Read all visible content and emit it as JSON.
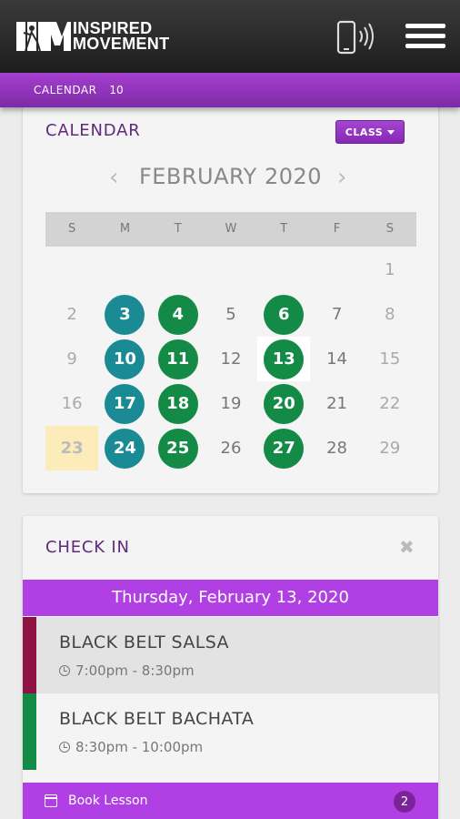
{
  "header": {
    "brand_line1": "INSPIRED",
    "brand_line2": "MOVEMENT",
    "logo_mark": "IM",
    "icons": [
      "phone-signal-icon",
      "hamburger-menu-icon"
    ]
  },
  "subnav": {
    "label": "CALENDAR",
    "count": "10"
  },
  "calendar": {
    "title": "CALENDAR",
    "class_button": "CLASS",
    "month": "FEBRUARY 2020",
    "prev_icon": "‹",
    "next_icon": "›",
    "weekdays": [
      "S",
      "M",
      "T",
      "W",
      "T",
      "F",
      "S"
    ],
    "weeks": [
      [
        {
          "d": ""
        },
        {
          "d": ""
        },
        {
          "d": ""
        },
        {
          "d": ""
        },
        {
          "d": ""
        },
        {
          "d": ""
        },
        {
          "d": "1"
        }
      ],
      [
        {
          "d": "2"
        },
        {
          "d": "3",
          "dot": "teal"
        },
        {
          "d": "4",
          "dot": "green"
        },
        {
          "d": "5",
          "cur": true
        },
        {
          "d": "6",
          "dot": "green"
        },
        {
          "d": "7",
          "cur": true
        },
        {
          "d": "8"
        }
      ],
      [
        {
          "d": "9"
        },
        {
          "d": "10",
          "dot": "teal"
        },
        {
          "d": "11",
          "dot": "green"
        },
        {
          "d": "12",
          "cur": true
        },
        {
          "d": "13",
          "dot": "green",
          "selected": true
        },
        {
          "d": "14",
          "cur": true
        },
        {
          "d": "15"
        }
      ],
      [
        {
          "d": "16"
        },
        {
          "d": "17",
          "dot": "teal"
        },
        {
          "d": "18",
          "dot": "green"
        },
        {
          "d": "19",
          "cur": true
        },
        {
          "d": "20",
          "dot": "green"
        },
        {
          "d": "21",
          "cur": true
        },
        {
          "d": "22"
        }
      ],
      [
        {
          "d": "23",
          "today": true
        },
        {
          "d": "24",
          "dot": "teal"
        },
        {
          "d": "25",
          "dot": "green"
        },
        {
          "d": "26",
          "cur": true
        },
        {
          "d": "27",
          "dot": "green"
        },
        {
          "d": "28",
          "cur": true
        },
        {
          "d": "29"
        }
      ]
    ],
    "colors": {
      "teal": "#1a8a94",
      "green": "#138a45",
      "today": "#fcecb9"
    }
  },
  "checkin": {
    "title": "CHECK IN",
    "close_icon": "✖",
    "date": "Thursday, February 13, 2020",
    "sessions": [
      {
        "name": "BLACK BELT SALSA",
        "time": "7:00pm - 8:30pm",
        "color": "#8e1242"
      },
      {
        "name": "BLACK BELT BACHATA",
        "time": "8:30pm - 10:00pm",
        "color": "#138a45"
      }
    ]
  },
  "footer": {
    "book_label": "Book Lesson",
    "book_count": "2"
  }
}
